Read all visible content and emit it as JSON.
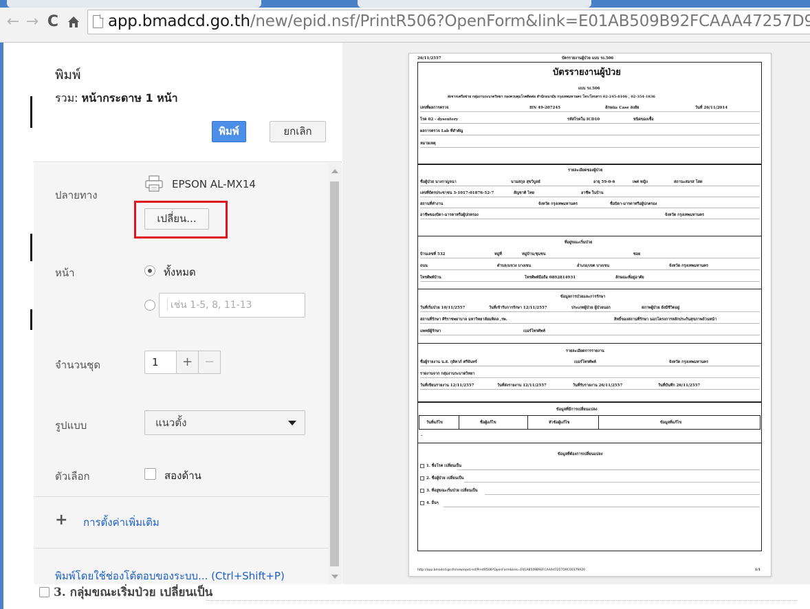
{
  "browser": {
    "url_host": "app.bmadcd.go.th",
    "url_path": "/new/epid.nsf/PrintR506?OpenForm&link=E01AB509B92FCAAA47257D9"
  },
  "print_dialog": {
    "title": "พิมพ์",
    "summary_prefix": "รวม: ",
    "summary_value": "หน้ากระดาษ 1 หน้า",
    "print_button": "พิมพ์",
    "cancel_button": "ยกเลิก",
    "destination_label": "ปลายทาง",
    "printer_name": "EPSON AL-MX14",
    "change_button": "เปลี่ยน...",
    "pages_label": "หน้า",
    "pages_all": "ทั้งหมด",
    "pages_placeholder": "เช่น 1-5, 8, 11-13",
    "copies_label": "จำนวนชุด",
    "copies_value": "1",
    "layout_label": "รูปแบบ",
    "layout_value": "แนวตั้ง",
    "options_label": "ตัวเลือก",
    "two_sided": "สองด้าน",
    "more_settings": "การตั้งค่าเพิ่มเติม",
    "system_dialog": "พิมพ์โดยใช้ช่องโต้ตอบของระบบ... (Ctrl+Shift+P)",
    "accent_color": "#4d8ee8",
    "highlight_color": "#e0141e"
  },
  "background_page": {
    "visible_line": "3. กลุ่มขณะเริ่มป่วย เปลี่ยนเป็น"
  },
  "preview": {
    "top_left": "26/11/2557",
    "top_center": "บัตรรายงานผู้ป่วย แบบ รง.506",
    "title": "บัตรรายงานผู้ป่วย",
    "form_code": "แบบ รง.506",
    "sender_line": "ส่งจากเครือข่าย กลุ่มงานระบาดวิทยา กองควบคุมโรคติดต่อ สำนักอนามัย กรุงเทพมหานคร โทร/โทรสาร 02-245-8106 , 02-354-1836",
    "row1": [
      "เลขที่ผลการตรวจ",
      "HN 49-207245",
      "ลักษณะ Case สงสัย",
      "วันที่ 26/11/2014"
    ],
    "row2": [
      "โรค 02 - dysentery",
      "รหัสโรคใน ICD10",
      "ชนิดของเชื้อ"
    ],
    "row3": "ผลการตรวจ Lab ที่สำคัญ",
    "row4": "หมายเหตุ",
    "sec_patient": "รายละเอียดของผู้ป่วย",
    "patient1": [
      "ชื่อผู้ป่วย นางกาญจนา",
      "นามสกุล สุขวิบูลย์",
      "อายุ 59-0-6",
      "เพศ หญิง",
      "สถานะสมรส โสด"
    ],
    "patient2": [
      "เลขที่บัตรประชาชน 3-1017-01876-52-7",
      "สัญชาติ ไทย",
      "อาชีพ ในบ้าน"
    ],
    "patient3": [
      "สถานที่ทำงาน",
      "จังหวัด กรุงเทพมหานคร",
      "ชื่อบิดา-มารดาหรือผู้ปกครอง"
    ],
    "patient4": [
      "อาชีพของบิดา-มารดาหรือผู้ปกครอง",
      "จังหวัด กรุงเทพมหานคร"
    ],
    "sec_address": "ที่อยู่ขณะเริ่มป่วย",
    "addr1": [
      "บ้านเลขที่ 532",
      "หมู่ที่",
      "หมู่บ้าน/ชุมชน",
      "ซอย"
    ],
    "addr2": [
      "ถนน",
      "ตำบล/แขวง บางเขน",
      "อำเภอ/เขต บางเขน",
      "จังหวัด กรุงเทพมหานคร"
    ],
    "addr3": [
      "โทรศัพท์บ้าน",
      "โทรศัพท์มือถือ 0892814931",
      "ลักษณะที่อยู่อาศัย"
    ],
    "sec_treatment": "ข้อมูลการป่วยและการรักษา",
    "treat1": [
      "วันที่เริ่มป่วย 10/11/2557",
      "วันที่เข้ารับการรักษา 12/11/2557",
      "ประเภทผู้ป่วย ผู้ป่วยนอก",
      "สภาพผู้ป่วย ยังมีชีวิตอยู่"
    ],
    "treat2": [
      "สถานที่รักษา ศิริราชพยาบาล มหาวิทยาลัยมหิดล ,รพ.",
      "สิทธิ์ของสถานที่รักษา นอกโครงการหลักประกันสุขภาพถ้วนหน้า"
    ],
    "treat3": [
      "แพทย์ผู้รักษา",
      "เบอร์โทรศัพท์"
    ],
    "sec_reporter": "รายละเอียดการรายงาน",
    "rep1": [
      "ชื่อผู้รายงาน น.ส. กุสิตาภ์ ศรีจันทร์",
      "เบอร์โทรศัพท์",
      "จังหวัด กรุงเทพมหานคร"
    ],
    "rep2": "รายงานจาก กลุ่มงานระบาดวิทยา",
    "rep3": [
      "วันที่เขียนรายงาน 12/11/2557",
      "วันที่ส่งรายงาน 12/11/2557",
      "วันที่รับรายงาน 26/11/2557",
      "วันที่บันทึก 26/11/2557"
    ],
    "sec_changes": "ข้อมูลที่มีการเปลี่ยนแปลง",
    "change_headers": [
      "วันที่แก้ไข",
      "ชื่อผู้แก้ไข",
      "หัวข้อผู้แก้ไข",
      "ข้อมูลที่แก้ไข"
    ],
    "change_row": "-",
    "sec_required": "ข้อมูลที่ต้องการเปลี่ยนแปลง",
    "req_items": [
      "1. ชื่อโรค เปลี่ยนเป็น",
      "2. ชื่อผู้ป่วย เปลี่ยนเป็น",
      "3. ที่อยู่ขณะเริ่มป่วย เปลี่ยนเป็น",
      "4. อื่นๆ"
    ],
    "footer_url": "http://app.bmadcd.go.th/new/epid.nsf/PrintR506?OpenForm&link=E01AB509B92FCAAA47257D9C00379A20",
    "footer_page": "1/1"
  }
}
